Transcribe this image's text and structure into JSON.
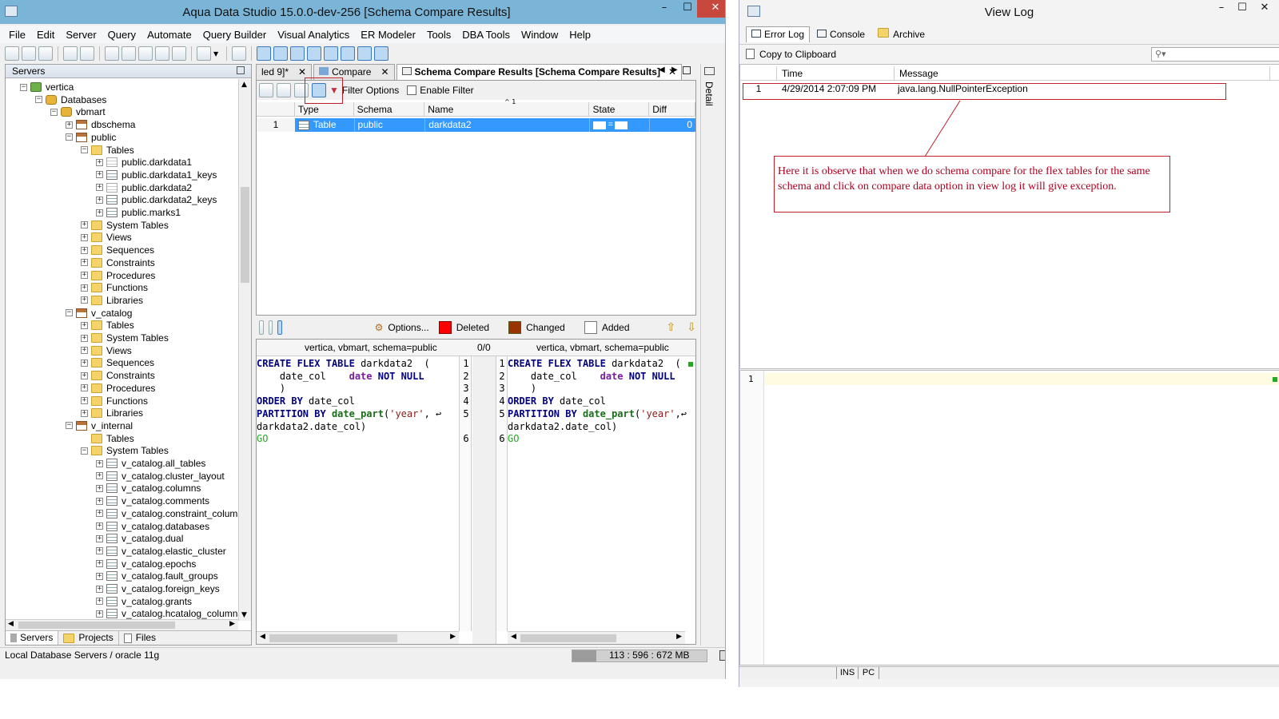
{
  "main_window": {
    "title": "Aqua Data Studio 15.0.0-dev-256 [Schema Compare Results]",
    "controls": {
      "minimize": "–",
      "maximize": "☐",
      "close": "✕"
    },
    "menu": [
      "File",
      "Edit",
      "Server",
      "Query",
      "Automate",
      "Query Builder",
      "Visual Analytics",
      "ER Modeler",
      "Tools",
      "DBA Tools",
      "Window",
      "Help"
    ],
    "servers_panel": {
      "title": "Servers",
      "tree": [
        {
          "label": "vertica",
          "level": 0,
          "icon": "server",
          "exp": "−"
        },
        {
          "label": "Databases",
          "level": 1,
          "icon": "db",
          "exp": "−"
        },
        {
          "label": "vbmart",
          "level": 2,
          "icon": "db",
          "exp": "−"
        },
        {
          "label": "dbschema",
          "level": 3,
          "icon": "schema",
          "exp": "+"
        },
        {
          "label": "public",
          "level": 3,
          "icon": "schema",
          "exp": "−"
        },
        {
          "label": "Tables",
          "level": 4,
          "icon": "folder",
          "exp": "−"
        },
        {
          "label": "public.darkdata1",
          "level": 5,
          "icon": "tablef",
          "exp": "+"
        },
        {
          "label": "public.darkdata1_keys",
          "level": 5,
          "icon": "table",
          "exp": "+"
        },
        {
          "label": "public.darkdata2",
          "level": 5,
          "icon": "tablef",
          "exp": "+"
        },
        {
          "label": "public.darkdata2_keys",
          "level": 5,
          "icon": "table",
          "exp": "+"
        },
        {
          "label": "public.marks1",
          "level": 5,
          "icon": "table",
          "exp": "+"
        },
        {
          "label": "System Tables",
          "level": 4,
          "icon": "folder",
          "exp": "+"
        },
        {
          "label": "Views",
          "level": 4,
          "icon": "folder",
          "exp": "+"
        },
        {
          "label": "Sequences",
          "level": 4,
          "icon": "folder",
          "exp": "+"
        },
        {
          "label": "Constraints",
          "level": 4,
          "icon": "folder",
          "exp": "+"
        },
        {
          "label": "Procedures",
          "level": 4,
          "icon": "folder",
          "exp": "+"
        },
        {
          "label": "Functions",
          "level": 4,
          "icon": "folder",
          "exp": "+"
        },
        {
          "label": "Libraries",
          "level": 4,
          "icon": "folder",
          "exp": "+"
        },
        {
          "label": "v_catalog",
          "level": 3,
          "icon": "schema",
          "exp": "−"
        },
        {
          "label": "Tables",
          "level": 4,
          "icon": "folder",
          "exp": "+"
        },
        {
          "label": "System Tables",
          "level": 4,
          "icon": "folder",
          "exp": "+"
        },
        {
          "label": "Views",
          "level": 4,
          "icon": "folder",
          "exp": "+"
        },
        {
          "label": "Sequences",
          "level": 4,
          "icon": "folder",
          "exp": "+"
        },
        {
          "label": "Constraints",
          "level": 4,
          "icon": "folder",
          "exp": "+"
        },
        {
          "label": "Procedures",
          "level": 4,
          "icon": "folder",
          "exp": "+"
        },
        {
          "label": "Functions",
          "level": 4,
          "icon": "folder",
          "exp": "+"
        },
        {
          "label": "Libraries",
          "level": 4,
          "icon": "folder",
          "exp": "+"
        },
        {
          "label": "v_internal",
          "level": 3,
          "icon": "schema",
          "exp": "−"
        },
        {
          "label": "Tables",
          "level": 4,
          "icon": "folder",
          "exp": ""
        },
        {
          "label": "System Tables",
          "level": 4,
          "icon": "folder",
          "exp": "−"
        },
        {
          "label": "v_catalog.all_tables",
          "level": 5,
          "icon": "table",
          "exp": "+"
        },
        {
          "label": "v_catalog.cluster_layout",
          "level": 5,
          "icon": "table",
          "exp": "+"
        },
        {
          "label": "v_catalog.columns",
          "level": 5,
          "icon": "table",
          "exp": "+"
        },
        {
          "label": "v_catalog.comments",
          "level": 5,
          "icon": "table",
          "exp": "+"
        },
        {
          "label": "v_catalog.constraint_columns",
          "level": 5,
          "icon": "table",
          "exp": "+"
        },
        {
          "label": "v_catalog.databases",
          "level": 5,
          "icon": "table",
          "exp": "+"
        },
        {
          "label": "v_catalog.dual",
          "level": 5,
          "icon": "table",
          "exp": "+"
        },
        {
          "label": "v_catalog.elastic_cluster",
          "level": 5,
          "icon": "table",
          "exp": "+"
        },
        {
          "label": "v_catalog.epochs",
          "level": 5,
          "icon": "table",
          "exp": "+"
        },
        {
          "label": "v_catalog.fault_groups",
          "level": 5,
          "icon": "table",
          "exp": "+"
        },
        {
          "label": "v_catalog.foreign_keys",
          "level": 5,
          "icon": "table",
          "exp": "+"
        },
        {
          "label": "v_catalog.grants",
          "level": 5,
          "icon": "table",
          "exp": "+"
        },
        {
          "label": "v_catalog.hcatalog_columns",
          "level": 5,
          "icon": "table",
          "exp": "+"
        }
      ],
      "bottom_tabs": [
        "Servers",
        "Projects",
        "Files"
      ]
    },
    "editor_tabs": {
      "t1": "led 9]*",
      "t2": "Compare",
      "t3": "Schema Compare Results [Schema Compare Results]"
    },
    "compare_toolbar": {
      "filter_options": "Filter Options",
      "enable_filter": "Enable Filter"
    },
    "results_table": {
      "sort_indicator": "^ 1",
      "columns": [
        "Type",
        "Schema",
        "Name",
        "State",
        "Diff Count"
      ],
      "rows": [
        {
          "num": "1",
          "type": "Table",
          "schema": "public",
          "name": "darkdata2",
          "state": "=",
          "diff": "0"
        }
      ]
    },
    "diff_toolbar": {
      "options": "Options...",
      "deleted": "Deleted",
      "changed": "Changed",
      "added": "Added"
    },
    "diff": {
      "left_header": "vertica, vbmart,  schema=public",
      "counter": "0/0",
      "right_header": "vertica, vbmart,  schema=public",
      "left_line_numbers": [
        "1",
        "2",
        "3",
        "4",
        "5",
        "",
        "6"
      ],
      "right_line_numbers": [
        "1",
        "2",
        "3",
        "4",
        "5",
        "",
        "6"
      ]
    },
    "detail_label": "Detail",
    "status_left": "Local Database Servers / oracle 11g",
    "status_mem": "113 : 596 : 672 MB",
    "colors": {
      "deleted": "#ff0000",
      "changed": "#993300",
      "added": "#ffffff",
      "selection": "#3399ff"
    }
  },
  "log_window": {
    "title": "View Log",
    "controls": {
      "minimize": "–",
      "maximize": "☐",
      "close": "✕"
    },
    "tabs": [
      "Error Log",
      "Console",
      "Archive"
    ],
    "copy_label": "Copy to Clipboard",
    "search_placeholder": "",
    "columns": [
      "Time",
      "Message"
    ],
    "rows": [
      {
        "num": "1",
        "time": "4/29/2014 2:07:09 PM",
        "message": "java.lang.NullPointerException"
      }
    ],
    "editor_line": "1",
    "status": {
      "ins": "INS",
      "pc": "PC"
    },
    "annotation": "Here it is observe that when we do schema compare for the flex tables for the same schema and click on compare data option in view log it will give exception."
  }
}
